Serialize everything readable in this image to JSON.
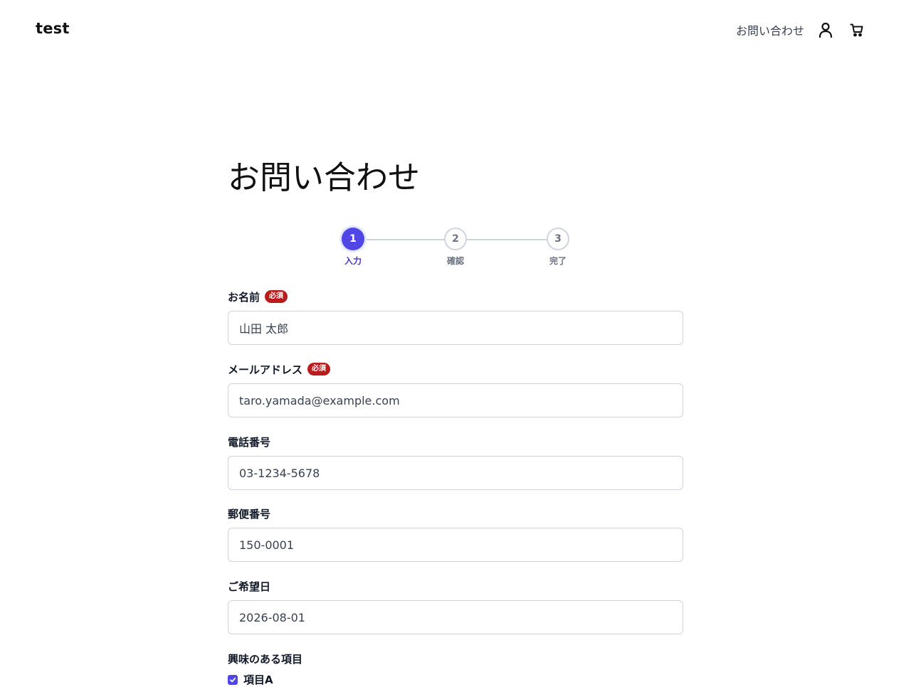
{
  "header": {
    "logo": "test",
    "nav_contact": "お問い合わせ",
    "account_icon": "user-icon",
    "cart_icon": "cart-icon"
  },
  "page": {
    "title": "お問い合わせ"
  },
  "stepper": {
    "steps": [
      {
        "number": "1",
        "label": "入力",
        "state": "active"
      },
      {
        "number": "2",
        "label": "確認",
        "state": "pending"
      },
      {
        "number": "3",
        "label": "完了",
        "state": "pending"
      }
    ]
  },
  "form": {
    "required_label": "必須",
    "name": {
      "label": "お名前",
      "value": "山田 太郎",
      "required": true
    },
    "email": {
      "label": "メールアドレス",
      "value": "taro.yamada@example.com",
      "required": true
    },
    "phone": {
      "label": "電話番号",
      "value": "03-1234-5678",
      "required": false
    },
    "postal": {
      "label": "郵便番号",
      "value": "150-0001",
      "required": false
    },
    "date": {
      "label": "ご希望日",
      "value": "2026-08-01",
      "required": false
    },
    "interests": {
      "label": "興味のある項目",
      "options": [
        {
          "label": "項目A",
          "checked": true
        }
      ]
    }
  },
  "colors": {
    "accent": "#4f46e5",
    "required_badge": "#b91c1c",
    "border": "#d1d5db"
  }
}
